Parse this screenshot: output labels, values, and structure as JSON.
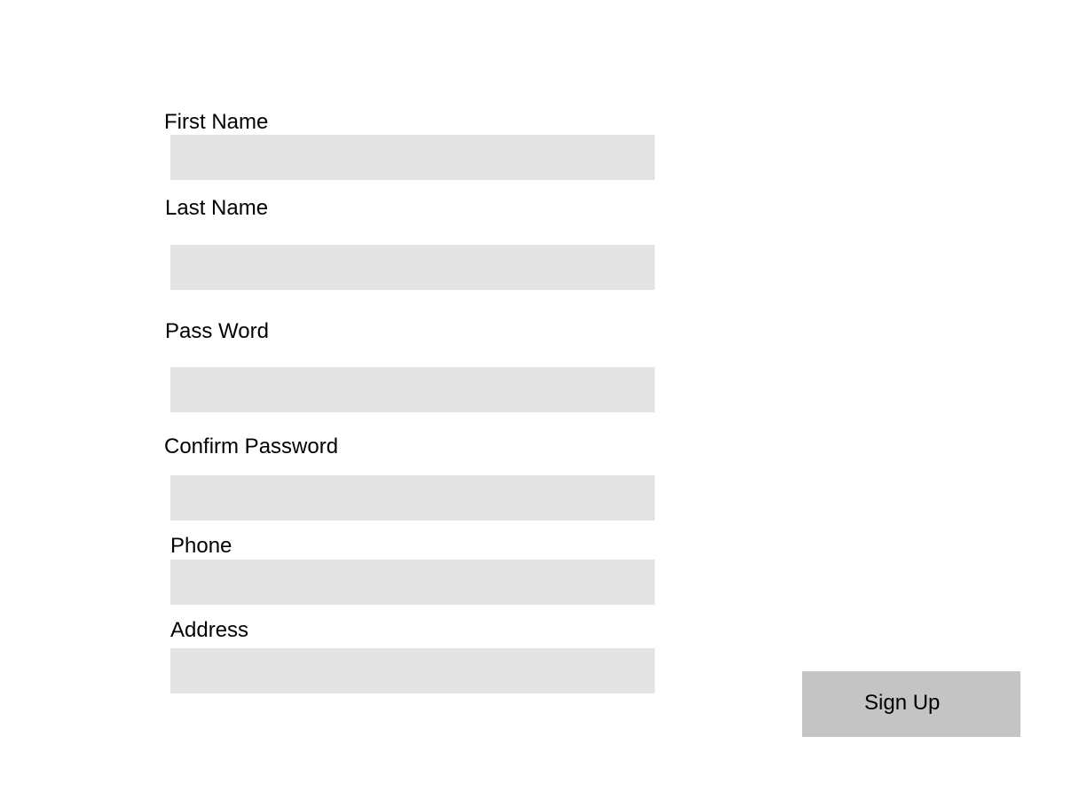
{
  "form": {
    "fields": {
      "first_name": {
        "label": "First Name",
        "value": ""
      },
      "last_name": {
        "label": "Last Name",
        "value": ""
      },
      "password": {
        "label": "Pass Word",
        "value": ""
      },
      "confirm_password": {
        "label": "Confirm Password",
        "value": ""
      },
      "phone": {
        "label": "Phone",
        "value": ""
      },
      "address": {
        "label": "Address",
        "value": ""
      }
    },
    "submit_label": "Sign Up"
  },
  "colors": {
    "background": "#ffffff",
    "field_background": "#e4e4e4",
    "button_background": "#c4c4c4",
    "text": "#000000"
  }
}
